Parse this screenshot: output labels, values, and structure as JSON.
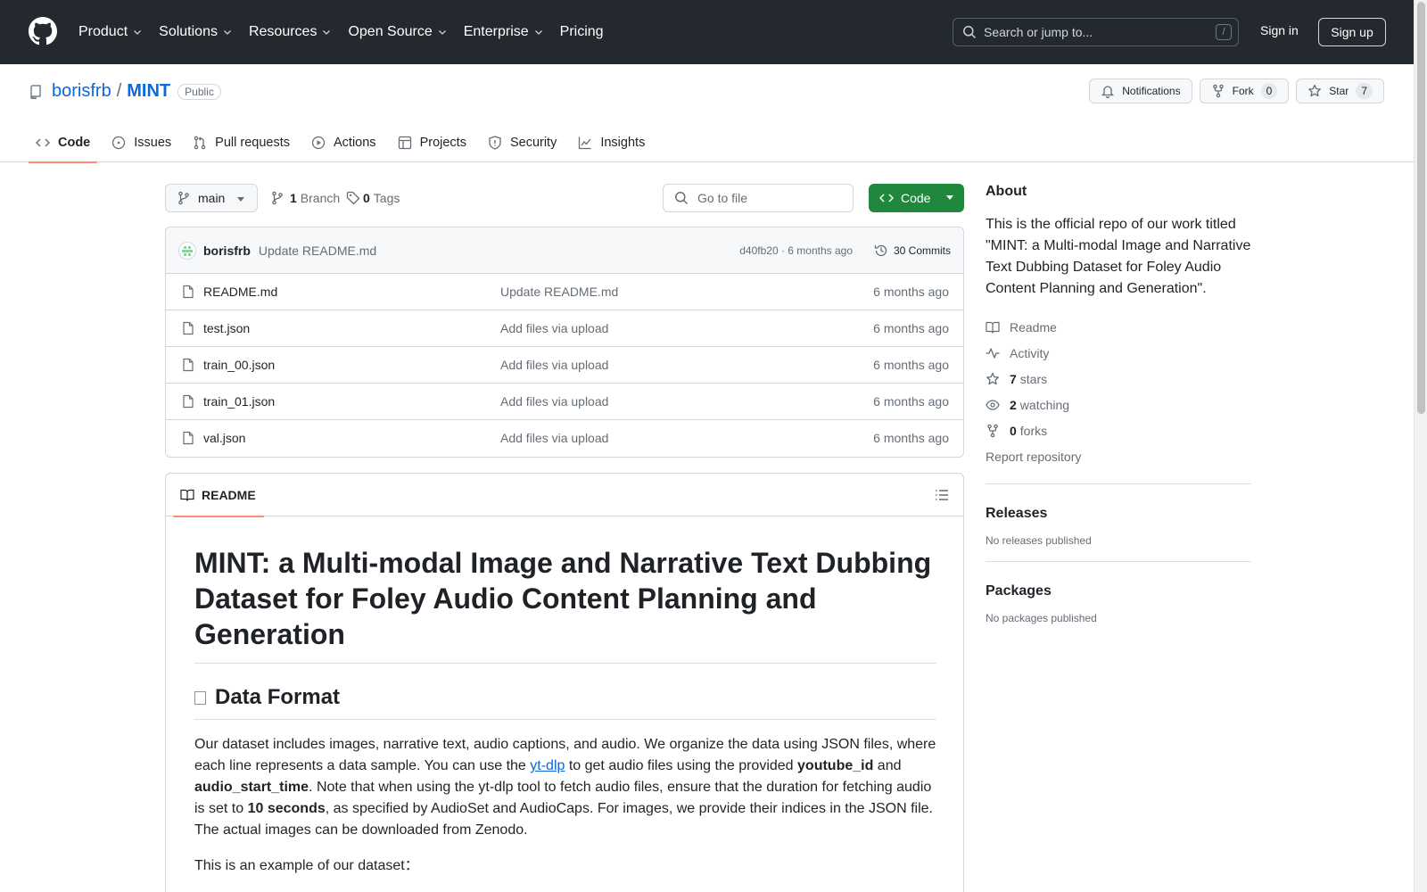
{
  "header": {
    "nav": [
      {
        "label": "Product",
        "has_menu": true
      },
      {
        "label": "Solutions",
        "has_menu": true
      },
      {
        "label": "Resources",
        "has_menu": true
      },
      {
        "label": "Open Source",
        "has_menu": true
      },
      {
        "label": "Enterprise",
        "has_menu": true
      },
      {
        "label": "Pricing",
        "has_menu": false
      }
    ],
    "search_placeholder": "Search or jump to...",
    "search_shortcut": "/",
    "sign_in": "Sign in",
    "sign_up": "Sign up"
  },
  "repo": {
    "owner": "borisfrb",
    "separator": "/",
    "name": "MINT",
    "visibility": "Public",
    "notifications_label": "Notifications",
    "fork_label": "Fork",
    "fork_count": "0",
    "star_label": "Star",
    "star_count": "7"
  },
  "tabs": [
    {
      "label": "Code",
      "icon": "code-icon",
      "selected": true
    },
    {
      "label": "Issues",
      "icon": "issue-icon",
      "selected": false
    },
    {
      "label": "Pull requests",
      "icon": "pull-request-icon",
      "selected": false
    },
    {
      "label": "Actions",
      "icon": "play-icon",
      "selected": false
    },
    {
      "label": "Projects",
      "icon": "table-icon",
      "selected": false
    },
    {
      "label": "Security",
      "icon": "shield-icon",
      "selected": false
    },
    {
      "label": "Insights",
      "icon": "graph-icon",
      "selected": false
    }
  ],
  "toolbar": {
    "branch": "main",
    "branch_count": "1",
    "branch_label": "Branch",
    "tag_count": "0",
    "tag_label": "Tags",
    "goto_placeholder": "Go to file",
    "code_label": "Code"
  },
  "commit": {
    "author": "borisfrb",
    "message": "Update README.md",
    "meta": "d40fb20 · 6 months ago",
    "count_label": "30 Commits"
  },
  "files": [
    {
      "name": "README.md",
      "message": "Update README.md",
      "age": "6 months ago"
    },
    {
      "name": "test.json",
      "message": "Add files via upload",
      "age": "6 months ago"
    },
    {
      "name": "train_00.json",
      "message": "Add files via upload",
      "age": "6 months ago"
    },
    {
      "name": "train_01.json",
      "message": "Add files via upload",
      "age": "6 months ago"
    },
    {
      "name": "val.json",
      "message": "Add files via upload",
      "age": "6 months ago"
    }
  ],
  "readme": {
    "tab_label": "README",
    "title": "MINT: a Multi-modal Image and Narrative Text Dubbing Dataset for Foley Audio Content Planning and Generation",
    "section_title": "Data Format",
    "p1_a": "Our dataset includes images, narrative text, audio captions, and audio. We organize the data using JSON files, where each line represents a data sample. You can use the ",
    "p1_link": "yt-dlp",
    "p1_b": " to get audio files using the provided ",
    "p1_bold1": "youtube_id",
    "p1_c": " and ",
    "p1_bold2": "audio_start_time",
    "p1_d": ". Note that when using the yt-dlp tool to fetch audio files, ensure that the duration for fetching audio is set to ",
    "p1_bold3": "10 seconds",
    "p1_e": ", as specified by AudioSet and AudioCaps. For images, we provide their indices in the JSON file. The actual images can be downloaded from Zenodo.",
    "p2": "This is an example of our dataset："
  },
  "sidebar": {
    "about_title": "About",
    "about_text": "This is the official repo of our work titled \"MINT: a Multi-modal Image and Narrative Text Dubbing Dataset for Foley Audio Content Planning and Generation\".",
    "readme_label": "Readme",
    "activity_label": "Activity",
    "stars_count": "7",
    "stars_label": "stars",
    "watching_count": "2",
    "watching_label": "watching",
    "forks_count": "0",
    "forks_label": "forks",
    "report_label": "Report repository",
    "releases_title": "Releases",
    "releases_text": "No releases published",
    "packages_title": "Packages",
    "packages_text": "No packages published"
  },
  "colors": {
    "header_bg": "#24292f",
    "link": "#0969da",
    "primary_button": "#1f883d",
    "tab_underline": "#fd8c73"
  }
}
